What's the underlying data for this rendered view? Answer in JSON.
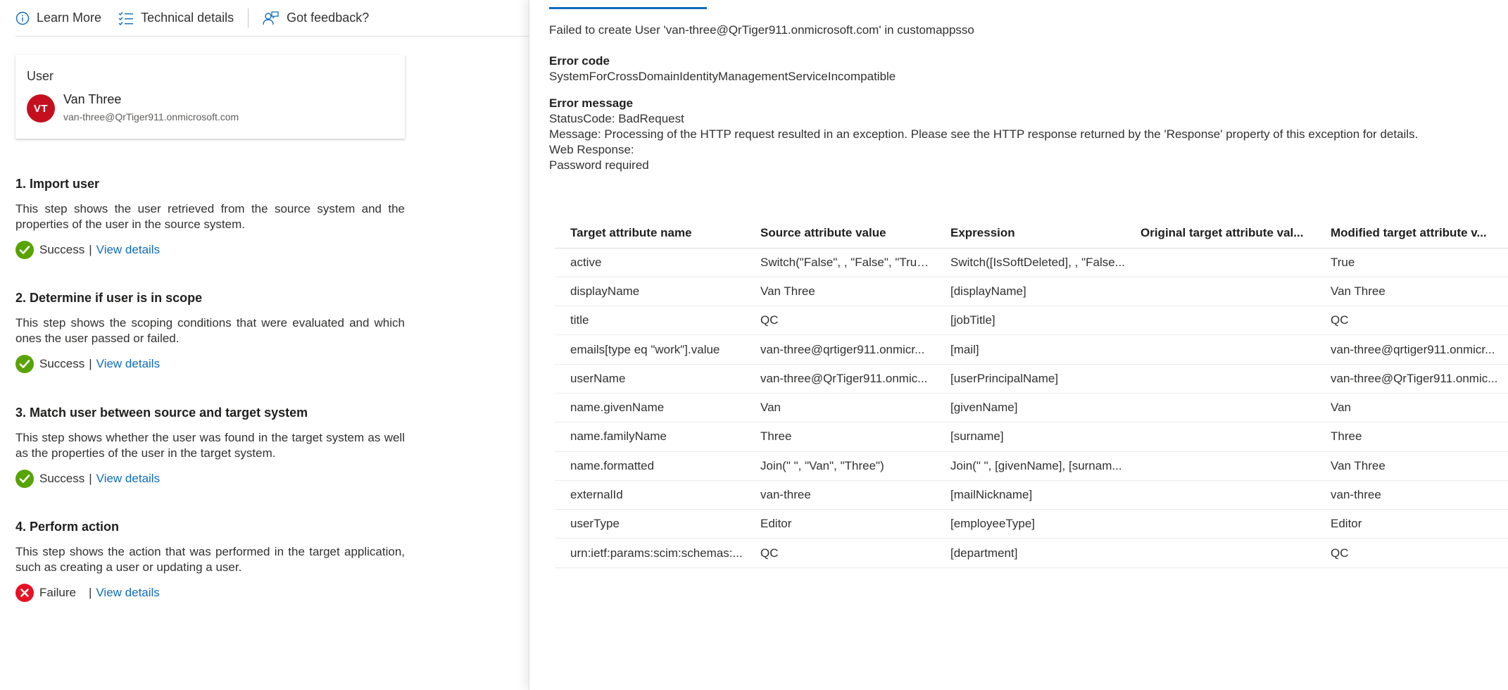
{
  "toolbar": {
    "learn_more": "Learn More",
    "technical_details": "Technical details",
    "feedback": "Got feedback?"
  },
  "user_card": {
    "title": "User",
    "initials": "VT",
    "name": "Van Three",
    "email": "van-three@QrTiger911.onmicrosoft.com",
    "avatar_color": "#c50f1f"
  },
  "steps": [
    {
      "title": "1. Import user",
      "description": "This step shows the user retrieved from the source system and the properties of the user in the source system.",
      "status": "Success",
      "status_type": "success",
      "link": "View details"
    },
    {
      "title": "2. Determine if user is in scope",
      "description": "This step shows the scoping conditions that were evaluated and which ones the user passed or failed.",
      "status": "Success",
      "status_type": "success",
      "link": "View details"
    },
    {
      "title": "3. Match user between source and target system",
      "description": "This step shows whether the user was found in the target system as well as the properties of the user in the target system.",
      "status": "Success",
      "status_type": "success",
      "link": "View details"
    },
    {
      "title": "4. Perform action",
      "description": "This step shows the action that was performed in the target application, such as creating a user or updating a user.",
      "status": "Failure",
      "status_type": "failure",
      "link": "View details"
    }
  ],
  "error": {
    "summary": "Failed to create User 'van-three@QrTiger911.onmicrosoft.com' in customappsso",
    "code_heading": "Error code",
    "code": "SystemForCrossDomainIdentityManagementServiceIncompatible",
    "message_heading": "Error message",
    "message_lines": [
      "StatusCode: BadRequest",
      "Message: Processing of the HTTP request resulted in an exception. Please see the HTTP response returned by the 'Response' property of this exception for details.",
      "Web Response:",
      "Password required"
    ]
  },
  "table": {
    "columns": [
      "Target attribute name",
      "Source attribute value",
      "Expression",
      "Original target attribute val...",
      "Modified target attribute v..."
    ],
    "rows": [
      [
        "active",
        "Switch(\"False\", , \"False\", \"True\",...",
        "Switch([IsSoftDeleted], , \"False...",
        "",
        "True"
      ],
      [
        "displayName",
        "Van Three",
        "[displayName]",
        "",
        "Van Three"
      ],
      [
        "title",
        "QC",
        "[jobTitle]",
        "",
        "QC"
      ],
      [
        "emails[type eq \"work\"].value",
        "van-three@qrtiger911.onmicr...",
        "[mail]",
        "",
        "van-three@qrtiger911.onmicr..."
      ],
      [
        "userName",
        "van-three@QrTiger911.onmic...",
        "[userPrincipalName]",
        "",
        "van-three@QrTiger911.onmic..."
      ],
      [
        "name.givenName",
        "Van",
        "[givenName]",
        "",
        "Van"
      ],
      [
        "name.familyName",
        "Three",
        "[surname]",
        "",
        "Three"
      ],
      [
        "name.formatted",
        "Join(\" \", \"Van\", \"Three\")",
        "Join(\" \", [givenName], [surnam...",
        "",
        "Van Three"
      ],
      [
        "externalId",
        "van-three",
        "[mailNickname]",
        "",
        "van-three"
      ],
      [
        "userType",
        "Editor",
        "[employeeType]",
        "",
        "Editor"
      ],
      [
        "urn:ietf:params:scim:schemas:...",
        "QC",
        "[department]",
        "",
        "QC"
      ]
    ]
  },
  "colors": {
    "link": "#0f6cbd",
    "success": "#57a300",
    "failure": "#e81123"
  }
}
